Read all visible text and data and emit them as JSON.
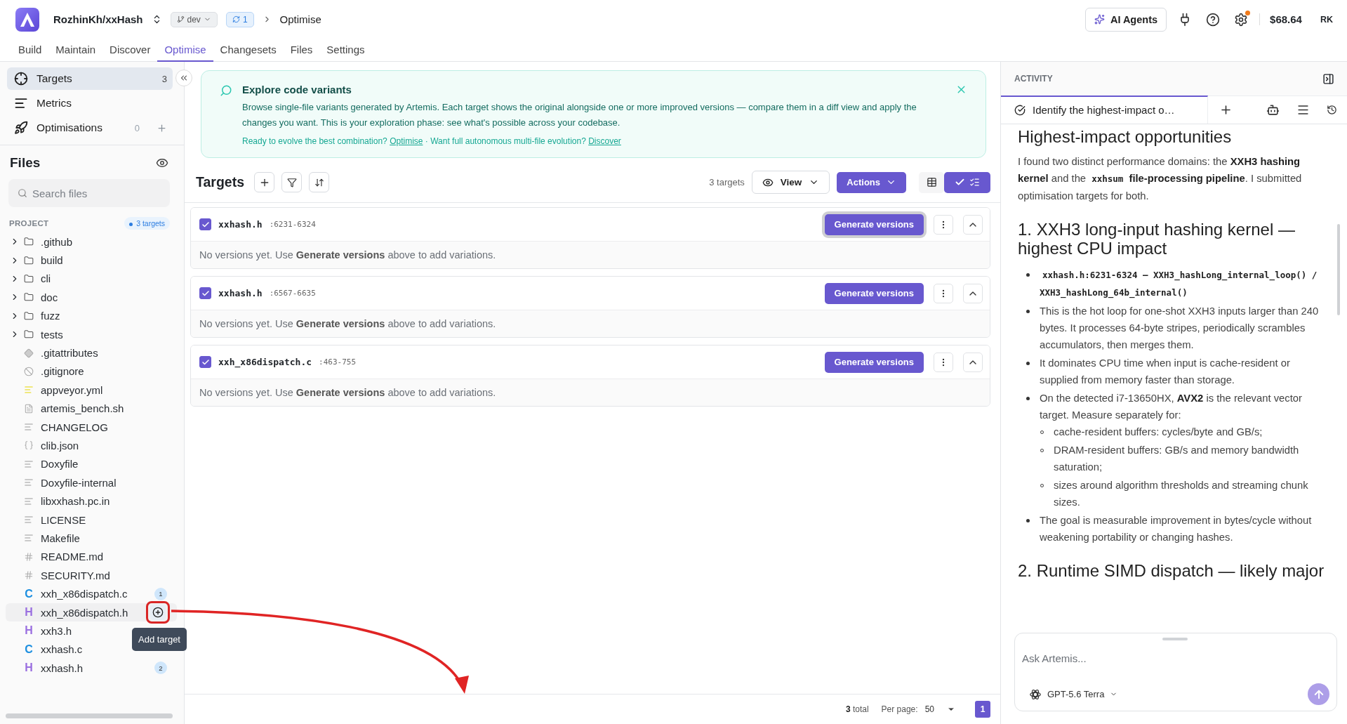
{
  "header": {
    "repo": "RozhinKh/xxHash",
    "branch": "dev",
    "sync_count": "1",
    "breadcrumb": "Optimise",
    "ai_agents": "AI Agents",
    "settings_alert": true,
    "balance": "$68.64",
    "user_initials": "RK"
  },
  "nav_tabs": [
    {
      "label": "Build",
      "selected": false
    },
    {
      "label": "Maintain",
      "selected": false
    },
    {
      "label": "Discover",
      "selected": false
    },
    {
      "label": "Optimise",
      "selected": true
    },
    {
      "label": "Changesets",
      "selected": false
    },
    {
      "label": "Files",
      "selected": false
    },
    {
      "label": "Settings",
      "selected": false
    }
  ],
  "sidebar": {
    "items": [
      {
        "kind": "targets",
        "label": "Targets",
        "count": "3",
        "selected": true
      },
      {
        "kind": "metrics",
        "label": "Metrics",
        "selected": false
      },
      {
        "kind": "optimisations",
        "label": "Optimisations",
        "count": "0",
        "selected": false
      }
    ]
  },
  "files": {
    "title": "Files",
    "search_placeholder": "Search files",
    "section": "PROJECT",
    "targets_badge": "3 targets",
    "tooltip": "Add target",
    "tree": [
      {
        "kind": "folder",
        "name": ".github",
        "expanded": false
      },
      {
        "kind": "folder",
        "name": "build",
        "expanded": false
      },
      {
        "kind": "folder",
        "name": "cli",
        "expanded": false
      },
      {
        "kind": "folder",
        "name": "doc",
        "expanded": false
      },
      {
        "kind": "folder",
        "name": "fuzz",
        "expanded": false
      },
      {
        "kind": "folder",
        "name": "tests",
        "expanded": false
      },
      {
        "kind": "git",
        "name": ".gitattributes"
      },
      {
        "kind": "ignore",
        "name": ".gitignore"
      },
      {
        "kind": "yaml",
        "name": "appveyor.yml"
      },
      {
        "kind": "script",
        "name": "artemis_bench.sh"
      },
      {
        "kind": "text",
        "name": "CHANGELOG"
      },
      {
        "kind": "json",
        "name": "clib.json"
      },
      {
        "kind": "text",
        "name": "Doxyfile"
      },
      {
        "kind": "text",
        "name": "Doxyfile-internal"
      },
      {
        "kind": "text",
        "name": "libxxhash.pc.in"
      },
      {
        "kind": "text",
        "name": "LICENSE"
      },
      {
        "kind": "text",
        "name": "Makefile"
      },
      {
        "kind": "markdown",
        "name": "README.md"
      },
      {
        "kind": "markdown",
        "name": "SECURITY.md"
      },
      {
        "kind": "source",
        "glyph": "C",
        "name": "xxh_x86dispatch.c",
        "badge": "1",
        "hovered": false
      },
      {
        "kind": "header",
        "glyph": "H",
        "name": "xxh_x86dispatch.h",
        "hovered": true
      },
      {
        "kind": "header",
        "glyph": "H",
        "name": "xxh3.h",
        "hovered": false
      },
      {
        "kind": "source",
        "glyph": "C",
        "name": "xxhash.c",
        "hovered": false
      },
      {
        "kind": "header",
        "glyph": "H",
        "name": "xxhash.h",
        "badge": "2",
        "hovered": false
      }
    ]
  },
  "banner": {
    "title": "Explore code variants",
    "body": "Browse single-file variants generated by Artemis. Each target shows the original alongside one or more improved versions — compare them in a diff view and apply the changes you want. This is your exploration phase: see what's possible across your codebase.",
    "footer": [
      {
        "text": "Ready to evolve the best combination? ",
        "link": "Optimise"
      },
      {
        "text": " · Want full autonomous multi-file evolution? ",
        "link": "Discover"
      }
    ]
  },
  "targets": {
    "title": "Targets",
    "count": "3 targets",
    "view": "View",
    "actions": "Actions",
    "view_modes": [
      {
        "kind": "grid",
        "selected": false
      },
      {
        "kind": "list",
        "selected": true
      }
    ],
    "items": [
      {
        "file": "xxhash.h",
        "range": ":6231-6324",
        "checked": true,
        "focused": true,
        "button": "Generate versions",
        "empty": "No versions yet. Use **Generate versions** above to add variations."
      },
      {
        "file": "xxhash.h",
        "range": ":6567-6635",
        "checked": true,
        "focused": false,
        "button": "Generate versions",
        "empty": "No versions yet. Use **Generate versions** above to add variations."
      },
      {
        "file": "xxh_x86dispatch.c",
        "range": ":463-755",
        "checked": true,
        "focused": false,
        "button": "Generate versions",
        "empty": "No versions yet. Use **Generate versions** above to add variations."
      }
    ]
  },
  "pagination": {
    "total_count": "3",
    "total_label": "total",
    "per_page_label": "Per page:",
    "per_page": "50",
    "pages": [
      {
        "label": "1",
        "selected": true
      }
    ]
  },
  "activity": {
    "title": "ACTIVITY",
    "tab": "Identify the highest-impact o…",
    "input_placeholder": "Ask Artemis...",
    "model": "GPT-5.6 Terra",
    "blocks": [
      {
        "kind": "heading",
        "text": "Highest-impact opportunities"
      },
      {
        "kind": "paragraph",
        "parts": [
          {
            "kind": "text",
            "text": "I found two distinct performance domains: the "
          },
          {
            "kind": "bold",
            "text": "XXH3 hashing kernel"
          },
          {
            "kind": "text",
            "text": " and the "
          },
          {
            "kind": "code",
            "text": "xxhsum"
          },
          {
            "kind": "bold",
            "text": " file-processing pipeline"
          },
          {
            "kind": "text",
            "text": ". I submitted optimisation targets for both."
          }
        ]
      },
      {
        "kind": "heading",
        "text": "1. XXH3 long-input hashing kernel — highest CPU impact"
      },
      {
        "kind": "list",
        "items": [
          {
            "parts": [
              {
                "kind": "code",
                "text": "xxhash.h:6231-6324 — XXH3_hashLong_internal_loop() / XXH3_hashLong_64b_internal()"
              }
            ]
          },
          {
            "parts": [
              {
                "kind": "text",
                "text": "This is the hot loop for one-shot XXH3 inputs larger than 240 bytes. It processes 64-byte stripes, periodically scrambles accumulators, then merges them."
              }
            ]
          },
          {
            "parts": [
              {
                "kind": "text",
                "text": "It dominates CPU time when input is cache-resident or supplied from memory faster than storage."
              }
            ]
          },
          {
            "parts": [
              {
                "kind": "text",
                "text": "On the detected i7-13650HX, "
              },
              {
                "kind": "bold",
                "text": "AVX2"
              },
              {
                "kind": "text",
                "text": " is the relevant vector target. Measure separately for:"
              }
            ],
            "children": [
              {
                "parts": [
                  {
                    "kind": "text",
                    "text": "cache-resident buffers: cycles/byte and GB/s;"
                  }
                ]
              },
              {
                "parts": [
                  {
                    "kind": "text",
                    "text": "DRAM-resident buffers: GB/s and memory bandwidth saturation;"
                  }
                ]
              },
              {
                "parts": [
                  {
                    "kind": "text",
                    "text": "sizes around algorithm thresholds and streaming chunk sizes."
                  }
                ]
              }
            ]
          },
          {
            "parts": [
              {
                "kind": "text",
                "text": "The goal is measurable improvement in bytes/cycle without weakening portability or changing hashes."
              }
            ]
          }
        ]
      },
      {
        "kind": "heading",
        "text": "2. Runtime SIMD dispatch — likely major"
      }
    ]
  }
}
